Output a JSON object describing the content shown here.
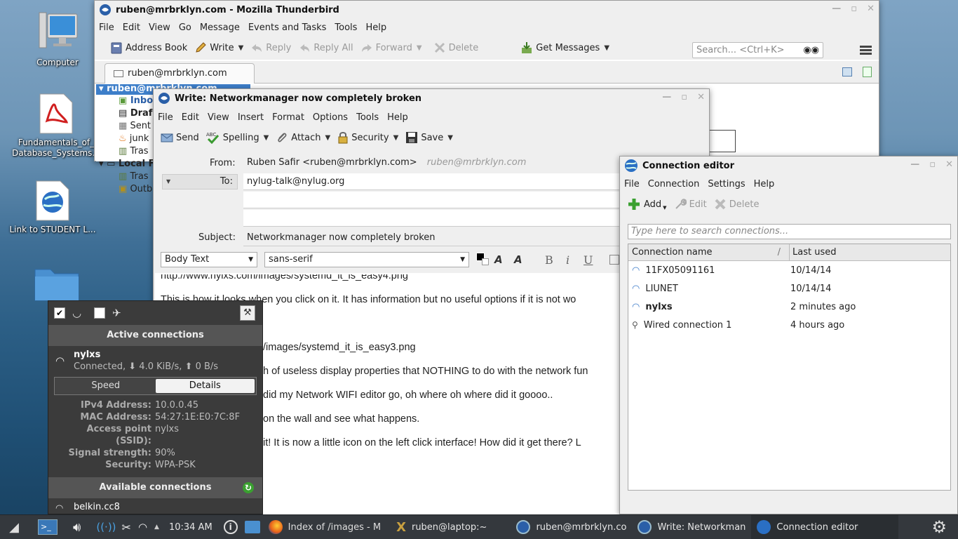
{
  "desktop": {
    "icons": [
      {
        "label": "Computer"
      },
      {
        "label": "Fundamentals_of_\nDatabase_Systems..."
      },
      {
        "label": "Link to STUDENT L..."
      }
    ]
  },
  "thunderbird": {
    "title": "ruben@mrbrklyn.com - Mozilla Thunderbird",
    "menu": [
      "File",
      "Edit",
      "View",
      "Go",
      "Message",
      "Events and Tasks",
      "Tools",
      "Help"
    ],
    "toolbar": {
      "address_book": "Address Book",
      "write": "Write",
      "reply": "Reply",
      "reply_all": "Reply All",
      "forward": "Forward",
      "delete": "Delete",
      "get_messages": "Get Messages",
      "search_placeholder": "Search... <Ctrl+K>"
    },
    "tab": "ruben@mrbrklyn.com",
    "folders": {
      "account": "ruben@mrbrklyn.com",
      "inbox": "Inbo",
      "drafts": "Draf",
      "sent": "Sent",
      "junk": "junk",
      "trash": "Tras",
      "local": "Local F",
      "local_trash": "Tras",
      "outbox": "Outb"
    }
  },
  "compose": {
    "title": "Write: Networkmanager now completely broken",
    "menu": [
      "File",
      "Edit",
      "View",
      "Insert",
      "Format",
      "Options",
      "Tools",
      "Help"
    ],
    "toolbar": {
      "send": "Send",
      "spelling": "Spelling",
      "attach": "Attach",
      "security": "Security",
      "save": "Save"
    },
    "from_label": "From:",
    "from_value": "Ruben Safir <ruben@mrbrklyn.com>",
    "from_hint": "ruben@mrbrklyn.com",
    "to_label": "To:",
    "to_value": "nylug-talk@nylug.org",
    "subject_label": "Subject:",
    "subject_value": "Networkmanager now completely broken",
    "format_paragraph": "Body Text",
    "format_font": "sans-serif",
    "body_lines": [
      "http://www.nylxs.com/images/systemd_it_is_easy4.png",
      "This is how it looks when you click on it.  It has information but no useful options if it is not wo",
      "/images/systemd_it_is_easy3.png",
      "h of useless display properties that NOTHING to do with the network fun",
      "did my Network WIFI editor go, oh where oh where did it goooo..",
      "on the wall and see what happens.",
      "it!  It is now a little icon on the left click interface!  How did it get there?  L"
    ]
  },
  "conn_editor": {
    "title": "Connection editor",
    "menu": [
      "File",
      "Connection",
      "Settings",
      "Help"
    ],
    "toolbar": {
      "add": "Add",
      "edit": "Edit",
      "delete": "Delete"
    },
    "search_placeholder": "Type here to search connections...",
    "columns": {
      "name": "Connection name",
      "sort_glyph": "/",
      "last_used": "Last used"
    },
    "rows": [
      {
        "name": "11FX05091161",
        "last_used": "10/14/14",
        "bold": false
      },
      {
        "name": "LIUNET",
        "last_used": "10/14/14",
        "bold": false
      },
      {
        "name": "nylxs",
        "last_used": "2 minutes ago",
        "bold": true
      },
      {
        "name": "Wired connection 1",
        "last_used": "4 hours ago",
        "bold": false
      }
    ]
  },
  "network_popup": {
    "active_header": "Active connections",
    "active_name": "nylxs",
    "active_status": "Connected, ⬇ 4.0 KiB/s, ⬆ 0 B/s",
    "tab_speed": "Speed",
    "tab_details": "Details",
    "details": [
      {
        "key": "IPv4 Address:",
        "value": "10.0.0.45"
      },
      {
        "key": "MAC Address:",
        "value": "54:27:1E:E0:7C:8F"
      },
      {
        "key": "Access point\n(SSID):",
        "value": "nylxs"
      },
      {
        "key": "Signal strength:",
        "value": "90%"
      },
      {
        "key": "Security:",
        "value": "WPA-PSK"
      }
    ],
    "available_header": "Available connections",
    "available_first": "belkin.cc8"
  },
  "taskbar": {
    "clock": "10:34 AM",
    "tasks": [
      "Index of /images - M",
      "ruben@laptop:~",
      "ruben@mrbrklyn.co",
      "Write: Networkman",
      "Connection editor"
    ]
  },
  "colors": {
    "panel": "#34383d",
    "selection": "#3d7ec9",
    "window_bg": "#efefef"
  }
}
